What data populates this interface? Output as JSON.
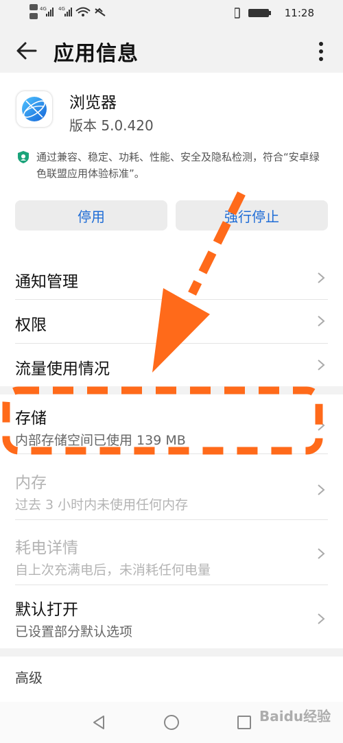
{
  "status": {
    "time": "11:28"
  },
  "header": {
    "title": "应用信息"
  },
  "app": {
    "name": "浏览器",
    "version": "版本 5.0.420",
    "certification": "通过兼容、稳定、功耗、性能、安全及隐私检测，符合“安卓绿色联盟应用体验标准”。"
  },
  "buttons": {
    "disable": "停用",
    "force_stop": "强行停止"
  },
  "menu": {
    "notification": "通知管理",
    "permissions": "权限",
    "data_usage": "流量使用情况",
    "storage": {
      "label": "存储",
      "sub": "内部存储空间已使用 139 MB"
    },
    "memory": {
      "label": "内存",
      "sub": "过去 3 小时内未使用任何内存"
    },
    "battery": {
      "label": "耗电详情",
      "sub": "自上次充满电后，未消耗任何电量"
    },
    "default_open": {
      "label": "默认打开",
      "sub": "已设置部分默认选项"
    }
  },
  "advanced": "高级",
  "watermark": "Baidu经验",
  "colors": {
    "accent": "#1e6cd6",
    "annotation": "#ff6a1a",
    "cert_icon": "#1aa37a"
  },
  "icons": [
    "back-arrow-icon",
    "more-vert-icon",
    "browser-globe-icon",
    "shield-icon",
    "chevron-right-icon",
    "nav-back-icon",
    "nav-home-icon",
    "nav-recents-icon"
  ]
}
